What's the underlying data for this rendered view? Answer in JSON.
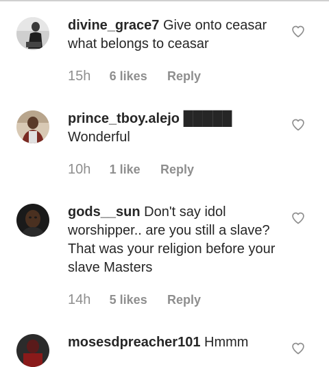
{
  "comments": [
    {
      "username": "divine_grace7",
      "text": "Give onto ceasar what belongs to ceasar",
      "time": "15h",
      "likes": "6 likes",
      "reply": "Reply"
    },
    {
      "username": "prince_tboy.alejo",
      "text": "█████ Wonderful",
      "time": "10h",
      "likes": "1 like",
      "reply": "Reply"
    },
    {
      "username": "gods__sun",
      "text": "Don't say idol worshipper.. are you still a slave? That was your religion before your slave Masters",
      "time": "14h",
      "likes": "5 likes",
      "reply": "Reply"
    },
    {
      "username": "mosesdpreacher101",
      "text": "Hmmm",
      "time": "",
      "likes": "",
      "reply": ""
    }
  ],
  "icons": {
    "like": "heart-outline-icon"
  },
  "colors": {
    "text": "#262626",
    "muted": "#8e8e8e",
    "heart_stroke": "#8e8e8e"
  }
}
